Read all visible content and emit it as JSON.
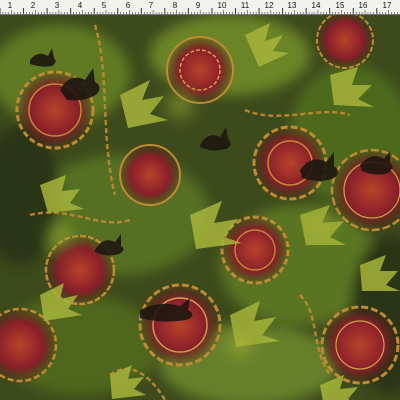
{
  "ruler": {
    "numbers": [
      "1",
      "2",
      "3",
      "4",
      "5",
      "6",
      "7",
      "8",
      "9",
      "10",
      "11",
      "12",
      "13",
      "14",
      "15",
      "16",
      "17"
    ]
  },
  "fabric": {
    "motif": "celtic-dragon-medallion-icon",
    "colors": {
      "base": "#3d4a1c",
      "moss": "#5f7a22",
      "lime": "#a6b53a",
      "rust": "#a3461e",
      "crimson": "#8a1f2a",
      "gold": "#c08a32",
      "shadow": "#1e1710"
    }
  }
}
